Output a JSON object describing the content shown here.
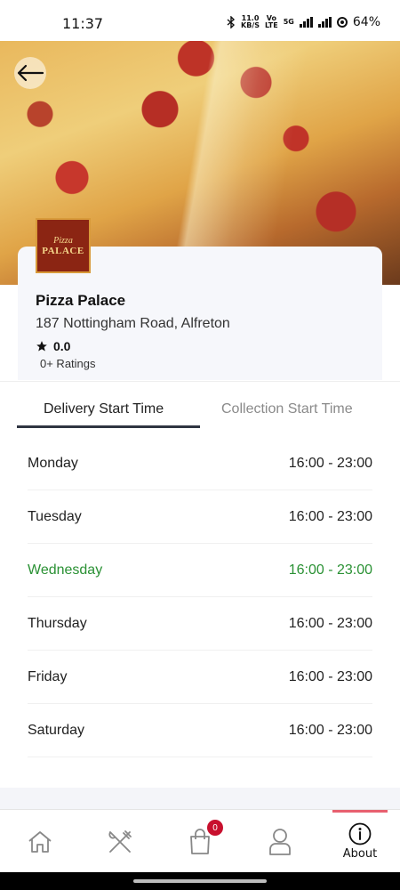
{
  "status_bar": {
    "time": "11:37",
    "net_speed_top": "11.0",
    "net_speed_bottom": "KB/S",
    "volte_top": "Vo",
    "volte_bottom": "LTE",
    "network": "5G",
    "battery": "64%"
  },
  "restaurant": {
    "logo_top": "Pizza",
    "logo_bottom": "PALACE",
    "name": "Pizza Palace",
    "address": "187 Nottingham Road, Alfreton",
    "rating": "0.0",
    "ratings_count": "0+ Ratings"
  },
  "tabs": [
    {
      "label": "Delivery Start Time",
      "active": true
    },
    {
      "label": "Collection Start Time",
      "active": false
    }
  ],
  "schedule": [
    {
      "day": "Monday",
      "hours": "16:00 - 23:00"
    },
    {
      "day": "Tuesday",
      "hours": "16:00 - 23:00"
    },
    {
      "day": "Wednesday",
      "hours": "16:00 - 23:00"
    },
    {
      "day": "Thursday",
      "hours": "16:00 - 23:00"
    },
    {
      "day": "Friday",
      "hours": "16:00 - 23:00"
    },
    {
      "day": "Saturday",
      "hours": "16:00 - 23:00"
    }
  ],
  "nav": {
    "basket_count": "0",
    "about_label": "About"
  },
  "icons": {
    "back": "arrow-left-icon",
    "home": "home-icon",
    "menu": "fork-knife-icon",
    "basket": "shopping-bag-icon",
    "account": "user-icon",
    "about": "info-icon"
  },
  "colors": {
    "today": "#2a9134",
    "badge": "#c8102e",
    "active_tab_line": "#2f3542",
    "about_active_line": "#e8606f"
  }
}
